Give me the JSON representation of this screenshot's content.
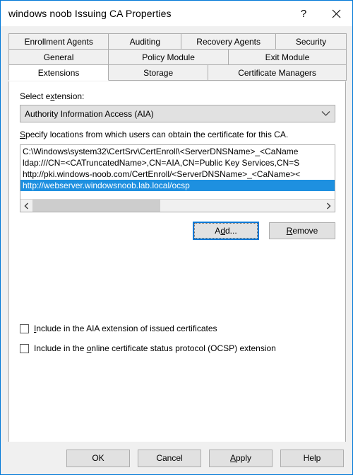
{
  "window": {
    "title": "windows noob Issuing CA Properties",
    "help_icon": "question-mark-icon",
    "close_icon": "close-icon",
    "accent_color": "#0078d7"
  },
  "tabs": {
    "row1": [
      {
        "label": "Enrollment Agents",
        "active": false
      },
      {
        "label": "Auditing",
        "active": false
      },
      {
        "label": "Recovery Agents",
        "active": false
      },
      {
        "label": "Security",
        "active": false
      }
    ],
    "row2": [
      {
        "label": "General",
        "active": false
      },
      {
        "label": "Policy Module",
        "active": false
      },
      {
        "label": "Exit Module",
        "active": false
      }
    ],
    "row3": [
      {
        "label": "Extensions",
        "active": true
      },
      {
        "label": "Storage",
        "active": false
      },
      {
        "label": "Certificate Managers",
        "active": false
      }
    ]
  },
  "extensions_pane": {
    "select_extension_label_pre": "Select e",
    "select_extension_accel": "x",
    "select_extension_label_post": "tension:",
    "selected_extension": "Authority Information Access (AIA)",
    "extension_options": [
      "Authority Information Access (AIA)"
    ],
    "dropdown_icon": "chevron-down-icon",
    "specify_label_accel": "S",
    "specify_label_post": "pecify locations from which users can obtain the certificate for this CA.",
    "locations": [
      {
        "text": "C:\\Windows\\system32\\CertSrv\\CertEnroll\\<ServerDNSName>_<CaName",
        "selected": false
      },
      {
        "text": "ldap:///CN=<CATruncatedName>,CN=AIA,CN=Public Key Services,CN=S",
        "selected": false
      },
      {
        "text": "http://pki.windows-noob.com/CertEnroll/<ServerDNSName>_<CaName><",
        "selected": false
      },
      {
        "text": "http://webserver.windowsnoob.lab.local/ocsp",
        "selected": true
      }
    ],
    "scroll_left_icon": "chevron-left-icon",
    "scroll_right_icon": "chevron-right-icon",
    "add_button": "Add...",
    "add_button_accel": "d",
    "remove_button_accel": "R",
    "remove_button_post": "emove",
    "checkbox_aia": {
      "accel": "I",
      "post": "nclude in the AIA extension of issued certificates",
      "checked": false
    },
    "checkbox_ocsp": {
      "pre": "Include in the ",
      "accel": "o",
      "post": "nline certificate status protocol (OCSP) extension",
      "checked": false
    },
    "selection_color": "#1e90e0"
  },
  "footer": {
    "ok": "OK",
    "cancel": "Cancel",
    "apply_accel": "A",
    "apply_post": "pply",
    "help": "Help"
  }
}
